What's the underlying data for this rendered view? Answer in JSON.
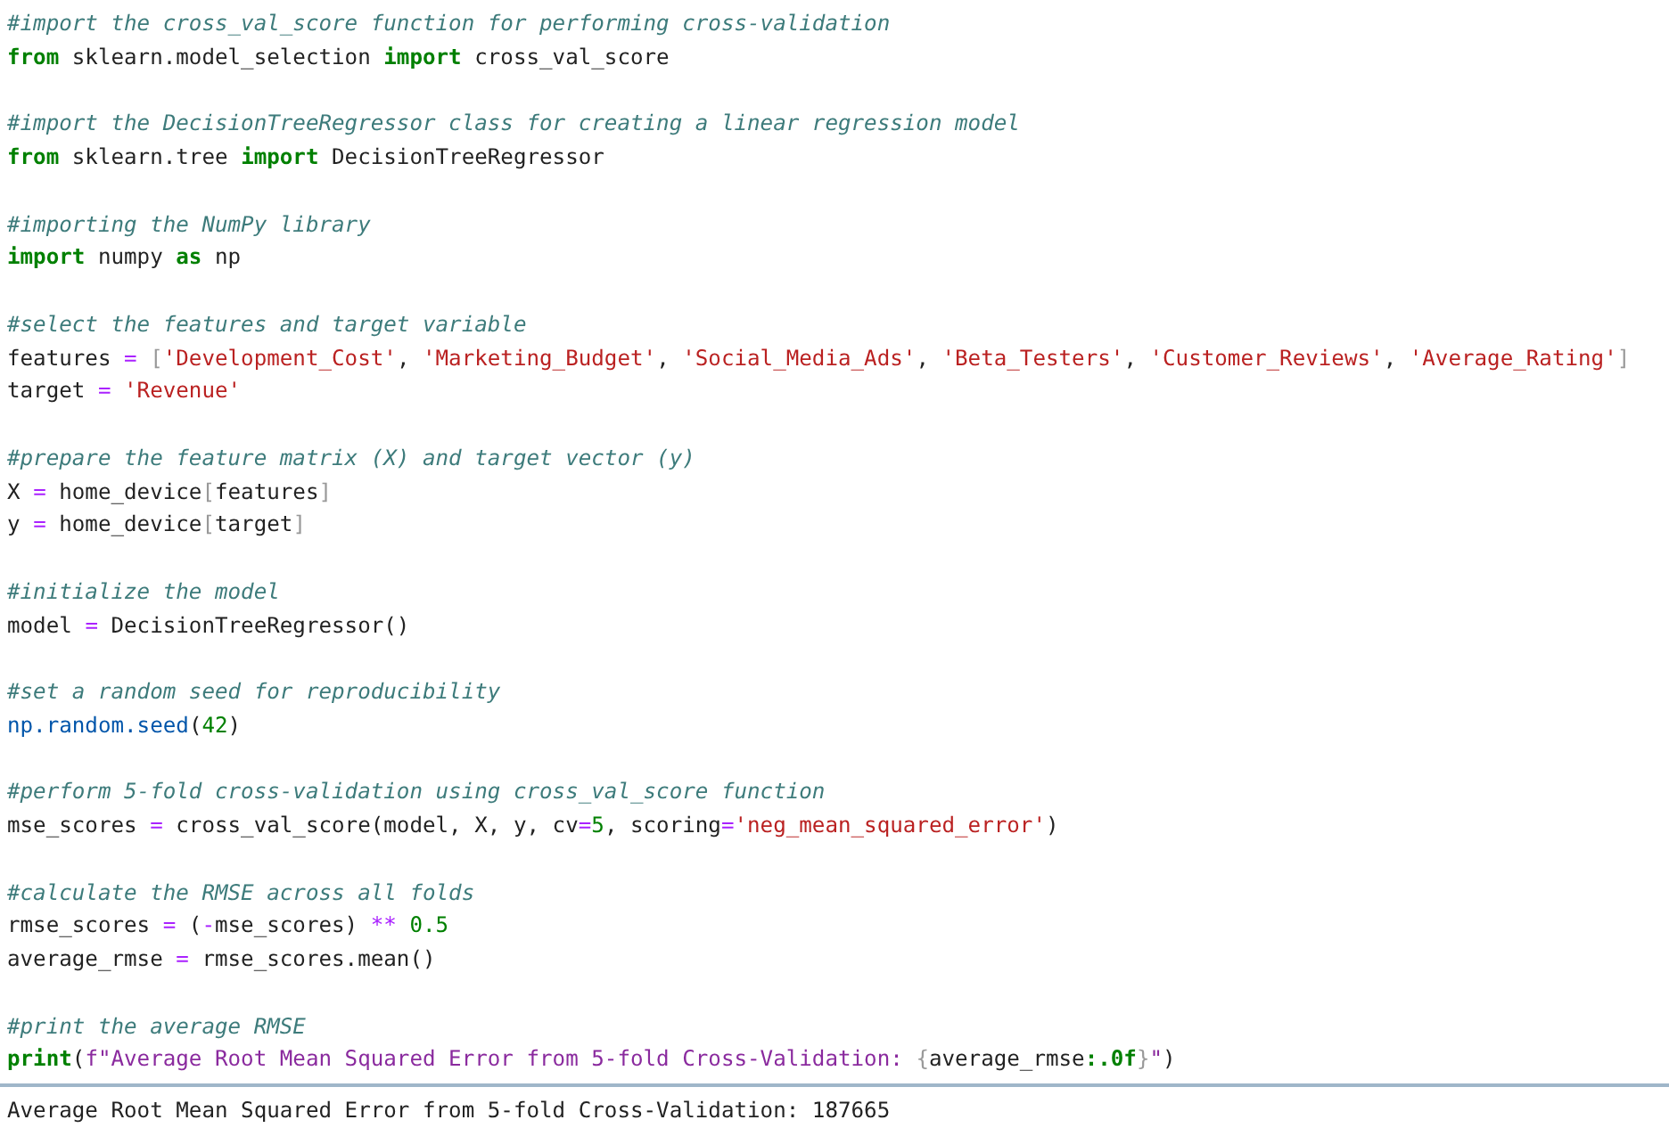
{
  "cell": {
    "blocks": [
      [
        [
          {
            "kind": "comment",
            "text": "#import the cross_val_score function for performing cross-validation"
          }
        ],
        [
          {
            "kind": "keyword",
            "text": "from"
          },
          {
            "kind": "plain",
            "text": " sklearn.model_selection "
          },
          {
            "kind": "keyword",
            "text": "import"
          },
          {
            "kind": "plain",
            "text": " cross_val_score"
          }
        ]
      ],
      [
        [
          {
            "kind": "comment",
            "text": "#import the DecisionTreeRegressor class for creating a linear regression model"
          }
        ],
        [
          {
            "kind": "keyword",
            "text": "from"
          },
          {
            "kind": "plain",
            "text": " sklearn.tree "
          },
          {
            "kind": "keyword",
            "text": "import"
          },
          {
            "kind": "plain",
            "text": " DecisionTreeRegressor"
          }
        ]
      ],
      [
        [
          {
            "kind": "comment",
            "text": "#importing the NumPy library"
          }
        ],
        [
          {
            "kind": "keyword",
            "text": "import"
          },
          {
            "kind": "plain",
            "text": " numpy "
          },
          {
            "kind": "keyword",
            "text": "as"
          },
          {
            "kind": "plain",
            "text": " np"
          }
        ]
      ],
      [
        [
          {
            "kind": "comment",
            "text": "#select the features and target variable"
          }
        ],
        [
          {
            "kind": "plain",
            "text": "features "
          },
          {
            "kind": "operator",
            "text": "= "
          },
          {
            "kind": "bracket",
            "text": "["
          },
          {
            "kind": "string",
            "text": "'Development_Cost'"
          },
          {
            "kind": "plain",
            "text": ", "
          },
          {
            "kind": "string",
            "text": "'Marketing_Budget'"
          },
          {
            "kind": "plain",
            "text": ", "
          },
          {
            "kind": "string",
            "text": "'Social_Media_Ads'"
          },
          {
            "kind": "plain",
            "text": ", "
          },
          {
            "kind": "string",
            "text": "'Beta_Testers'"
          },
          {
            "kind": "plain",
            "text": ", "
          },
          {
            "kind": "string",
            "text": "'Customer_Reviews'"
          },
          {
            "kind": "plain",
            "text": ", "
          },
          {
            "kind": "string",
            "text": "'Average_Rating'"
          },
          {
            "kind": "bracket",
            "text": "]"
          }
        ],
        [
          {
            "kind": "plain",
            "text": "target "
          },
          {
            "kind": "operator",
            "text": "= "
          },
          {
            "kind": "string",
            "text": "'Revenue'"
          }
        ]
      ],
      [
        [
          {
            "kind": "comment",
            "text": "#prepare the feature matrix (X) and target vector (y)"
          }
        ],
        [
          {
            "kind": "plain",
            "text": "X "
          },
          {
            "kind": "operator",
            "text": "="
          },
          {
            "kind": "plain",
            "text": " home_device"
          },
          {
            "kind": "bracket",
            "text": "["
          },
          {
            "kind": "plain",
            "text": "features"
          },
          {
            "kind": "bracket",
            "text": "]"
          }
        ],
        [
          {
            "kind": "plain",
            "text": "y "
          },
          {
            "kind": "operator",
            "text": "="
          },
          {
            "kind": "plain",
            "text": " home_device"
          },
          {
            "kind": "bracket",
            "text": "["
          },
          {
            "kind": "plain",
            "text": "target"
          },
          {
            "kind": "bracket",
            "text": "]"
          }
        ]
      ],
      [
        [
          {
            "kind": "comment",
            "text": "#initialize the model"
          }
        ],
        [
          {
            "kind": "plain",
            "text": "model "
          },
          {
            "kind": "operator",
            "text": "="
          },
          {
            "kind": "plain",
            "text": " DecisionTreeRegressor()"
          }
        ]
      ],
      [
        [
          {
            "kind": "comment",
            "text": "#set a random seed for reproducibility"
          }
        ],
        [
          {
            "kind": "attribute",
            "text": "np.random.seed"
          },
          {
            "kind": "plain",
            "text": "("
          },
          {
            "kind": "number",
            "text": "42"
          },
          {
            "kind": "plain",
            "text": ")"
          }
        ]
      ],
      [
        [
          {
            "kind": "comment",
            "text": "#perform 5-fold cross-validation using cross_val_score function"
          }
        ],
        [
          {
            "kind": "plain",
            "text": "mse_scores "
          },
          {
            "kind": "operator",
            "text": "="
          },
          {
            "kind": "plain",
            "text": " cross_val_score(model, X, y, cv"
          },
          {
            "kind": "operator",
            "text": "="
          },
          {
            "kind": "number",
            "text": "5"
          },
          {
            "kind": "plain",
            "text": ", scoring"
          },
          {
            "kind": "operator",
            "text": "="
          },
          {
            "kind": "string",
            "text": "'neg_mean_squared_error'"
          },
          {
            "kind": "plain",
            "text": ")"
          }
        ]
      ],
      [
        [
          {
            "kind": "comment",
            "text": "#calculate the RMSE across all folds"
          }
        ],
        [
          {
            "kind": "plain",
            "text": "rmse_scores "
          },
          {
            "kind": "operator",
            "text": "="
          },
          {
            "kind": "plain",
            "text": " ("
          },
          {
            "kind": "operator",
            "text": "-"
          },
          {
            "kind": "plain",
            "text": "mse_scores) "
          },
          {
            "kind": "operator",
            "text": "** "
          },
          {
            "kind": "number",
            "text": "0.5"
          }
        ],
        [
          {
            "kind": "plain",
            "text": "average_rmse "
          },
          {
            "kind": "operator",
            "text": "="
          },
          {
            "kind": "plain",
            "text": " rmse_scores.mean()"
          }
        ]
      ],
      [
        [
          {
            "kind": "comment",
            "text": "#print the average RMSE"
          }
        ],
        [
          {
            "kind": "keyword",
            "text": "print"
          },
          {
            "kind": "plain",
            "text": "("
          },
          {
            "kind": "fstring",
            "text": "f\"Average Root Mean Squared Error from 5-fold Cross-Validation: "
          },
          {
            "kind": "bracket",
            "text": "{"
          },
          {
            "kind": "plain",
            "text": "average_rmse"
          },
          {
            "kind": "format",
            "text": ":.0f"
          },
          {
            "kind": "bracket",
            "text": "}"
          },
          {
            "kind": "fstring",
            "text": "\""
          },
          {
            "kind": "plain",
            "text": ")"
          }
        ]
      ]
    ]
  },
  "output": "Average Root Mean Squared Error from 5-fold Cross-Validation: 187665"
}
